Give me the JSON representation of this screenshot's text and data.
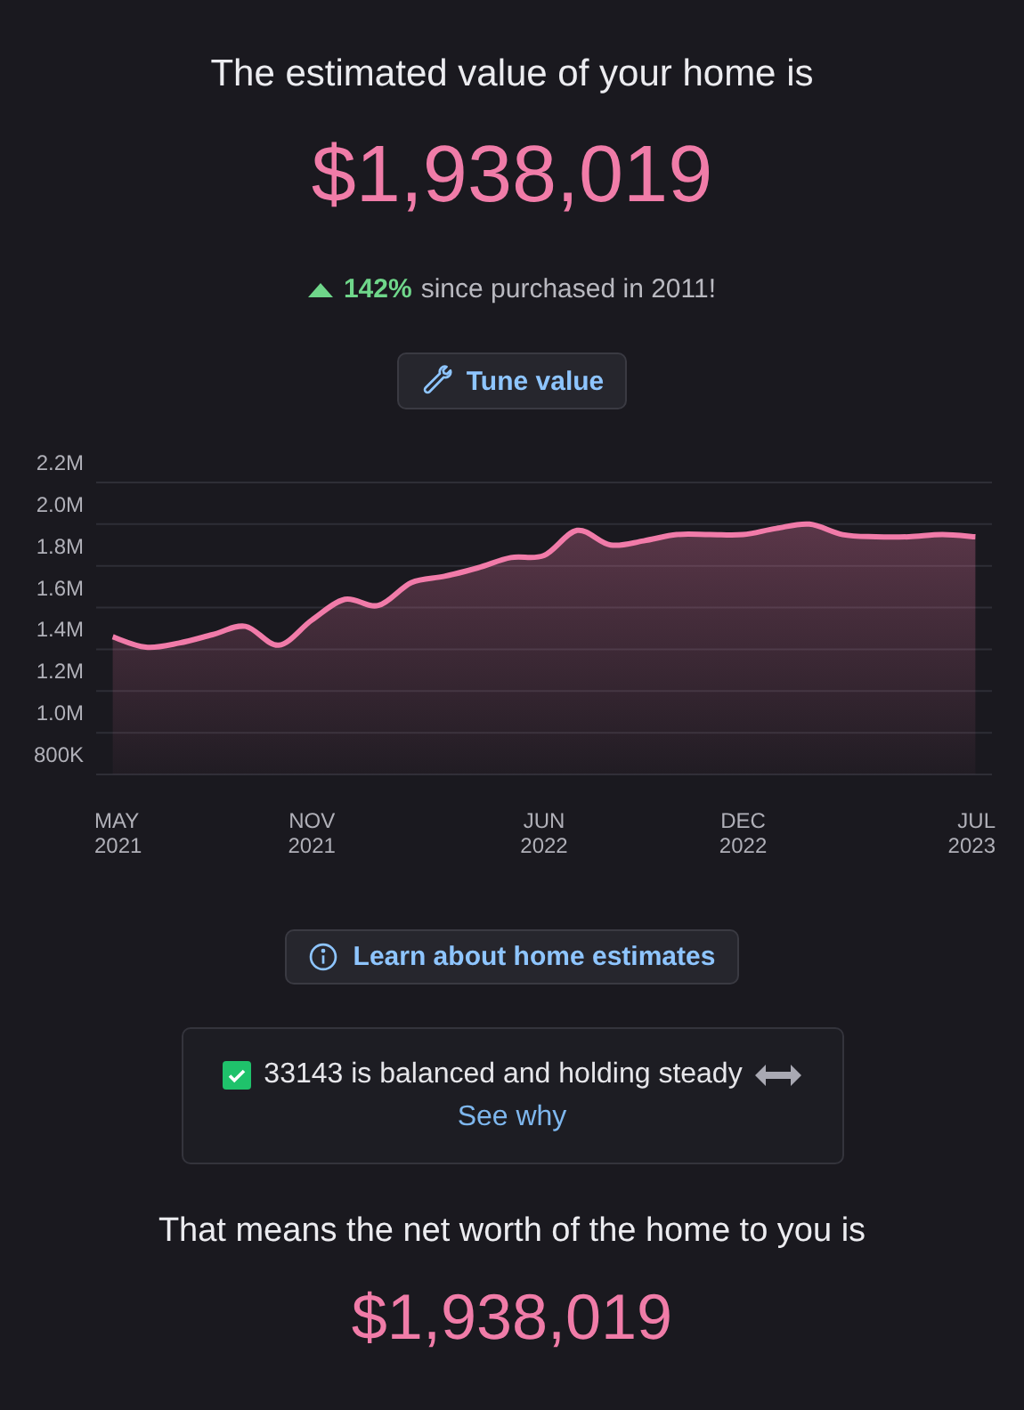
{
  "headline": "The estimated value of your home is",
  "value": "$1,938,019",
  "change": {
    "increase": true,
    "percent": "142%",
    "text": "since purchased in 2011!"
  },
  "tune_button": "Tune value",
  "chart_data": {
    "type": "area",
    "categories": [
      "MAY 2021",
      null,
      null,
      null,
      null,
      null,
      "NOV 2021",
      null,
      null,
      null,
      null,
      null,
      null,
      "JUN 2022",
      null,
      null,
      null,
      null,
      null,
      "DEC 2022",
      null,
      null,
      null,
      null,
      null,
      null,
      "JUL 2023"
    ],
    "series": [
      {
        "color": "#f17ba9",
        "values": [
          1460000,
          1410000,
          1430000,
          1470000,
          1510000,
          1420000,
          1540000,
          1640000,
          1610000,
          1720000,
          1750000,
          1790000,
          1840000,
          1850000,
          1970000,
          1900000,
          1920000,
          1950000,
          1950000,
          1950000,
          1980000,
          2000000,
          1950000,
          1940000,
          1940000,
          1950000,
          1940000
        ]
      }
    ],
    "ylim": [
      800000,
      2200000
    ],
    "grid": true,
    "yticks": [
      {
        "value": 2200000,
        "label": "2.2M"
      },
      {
        "value": 2000000,
        "label": "2.0M"
      },
      {
        "value": 1800000,
        "label": "1.8M"
      },
      {
        "value": 1600000,
        "label": "1.6M"
      },
      {
        "value": 1400000,
        "label": "1.4M"
      },
      {
        "value": 1200000,
        "label": "1.2M"
      },
      {
        "value": 1000000,
        "label": "1.0M"
      },
      {
        "value": 800000,
        "label": "800K"
      }
    ]
  },
  "learn_button": "Learn about home estimates",
  "market_card": {
    "text": "33143 is balanced and holding steady",
    "link": "See why"
  },
  "net_worth": {
    "label": "That means the net worth of the home to you is",
    "value": "$1,938,019"
  }
}
